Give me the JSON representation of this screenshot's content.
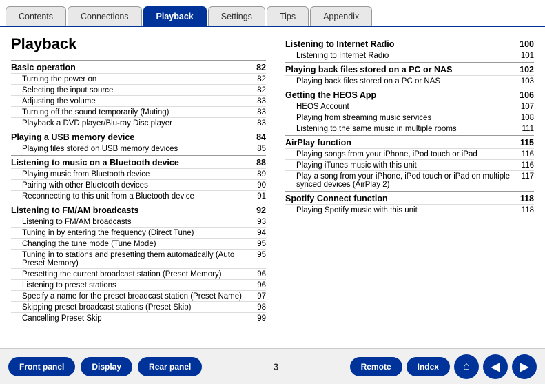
{
  "tabs": [
    {
      "id": "contents",
      "label": "Contents",
      "active": false
    },
    {
      "id": "connections",
      "label": "Connections",
      "active": false
    },
    {
      "id": "playback",
      "label": "Playback",
      "active": true
    },
    {
      "id": "settings",
      "label": "Settings",
      "active": false
    },
    {
      "id": "tips",
      "label": "Tips",
      "active": false
    },
    {
      "id": "appendix",
      "label": "Appendix",
      "active": false
    }
  ],
  "page_title": "Playback",
  "left_sections": [
    {
      "header": "Basic operation",
      "header_page": "82",
      "items": [
        {
          "label": "Turning the power on",
          "page": "82"
        },
        {
          "label": "Selecting the input source",
          "page": "82"
        },
        {
          "label": "Adjusting the volume",
          "page": "83"
        },
        {
          "label": "Turning off the sound temporarily (Muting)",
          "page": "83"
        },
        {
          "label": "Playback a DVD player/Blu-ray Disc player",
          "page": "83"
        }
      ]
    },
    {
      "header": "Playing a USB memory device",
      "header_page": "84",
      "items": [
        {
          "label": "Playing files stored on USB memory devices",
          "page": "85"
        }
      ]
    },
    {
      "header": "Listening to music on a Bluetooth device",
      "header_page": "88",
      "items": [
        {
          "label": "Playing music from Bluetooth device",
          "page": "89"
        },
        {
          "label": "Pairing with other Bluetooth devices",
          "page": "90"
        },
        {
          "label": "Reconnecting to this unit from a Bluetooth device",
          "page": "91"
        }
      ]
    },
    {
      "header": "Listening to FM/AM broadcasts",
      "header_page": "92",
      "items": [
        {
          "label": "Listening to FM/AM broadcasts",
          "page": "93"
        },
        {
          "label": "Tuning in by entering the frequency (Direct Tune)",
          "page": "94"
        },
        {
          "label": "Changing the tune mode (Tune Mode)",
          "page": "95"
        },
        {
          "label": "Tuning in to stations and presetting them automatically (Auto Preset Memory)",
          "page": "95"
        },
        {
          "label": "Presetting the current broadcast station (Preset Memory)",
          "page": "96"
        },
        {
          "label": "Listening to preset stations",
          "page": "96"
        },
        {
          "label": "Specify a name for the preset broadcast station (Preset Name)",
          "page": "97"
        },
        {
          "label": "Skipping preset broadcast stations (Preset Skip)",
          "page": "98"
        },
        {
          "label": "Cancelling Preset Skip",
          "page": "99"
        }
      ]
    }
  ],
  "right_sections": [
    {
      "header": "Listening to Internet Radio",
      "header_page": "100",
      "items": [
        {
          "label": "Listening to Internet Radio",
          "page": "101"
        }
      ]
    },
    {
      "header": "Playing back files stored on a PC or NAS",
      "header_page": "102",
      "items": [
        {
          "label": "Playing back files stored on a PC or NAS",
          "page": "103"
        }
      ]
    },
    {
      "header": "Getting the HEOS App",
      "header_page": "106",
      "items": [
        {
          "label": "HEOS Account",
          "page": "107"
        },
        {
          "label": "Playing from streaming music services",
          "page": "108"
        },
        {
          "label": "Listening to the same music in multiple rooms",
          "page": "111"
        }
      ]
    },
    {
      "header": "AirPlay function",
      "header_page": "115",
      "items": [
        {
          "label": "Playing songs from your iPhone, iPod touch or iPad",
          "page": "116"
        },
        {
          "label": "Playing iTunes music with this unit",
          "page": "116"
        },
        {
          "label": "Play a song from your iPhone, iPod touch or iPad on multiple synced devices (AirPlay 2)",
          "page": "117"
        }
      ]
    },
    {
      "header": "Spotify Connect function",
      "header_page": "118",
      "items": [
        {
          "label": "Playing Spotify music with this unit",
          "page": "118"
        }
      ]
    }
  ],
  "footer": {
    "buttons": [
      {
        "id": "front-panel",
        "label": "Front panel"
      },
      {
        "id": "display",
        "label": "Display"
      },
      {
        "id": "rear-panel",
        "label": "Rear panel"
      }
    ],
    "page_number": "3",
    "right_buttons": [
      {
        "id": "remote",
        "label": "Remote"
      },
      {
        "id": "index",
        "label": "Index"
      }
    ],
    "nav_icons": [
      {
        "id": "home",
        "symbol": "⌂"
      },
      {
        "id": "back",
        "symbol": "◀"
      },
      {
        "id": "forward",
        "symbol": "▶"
      }
    ]
  }
}
